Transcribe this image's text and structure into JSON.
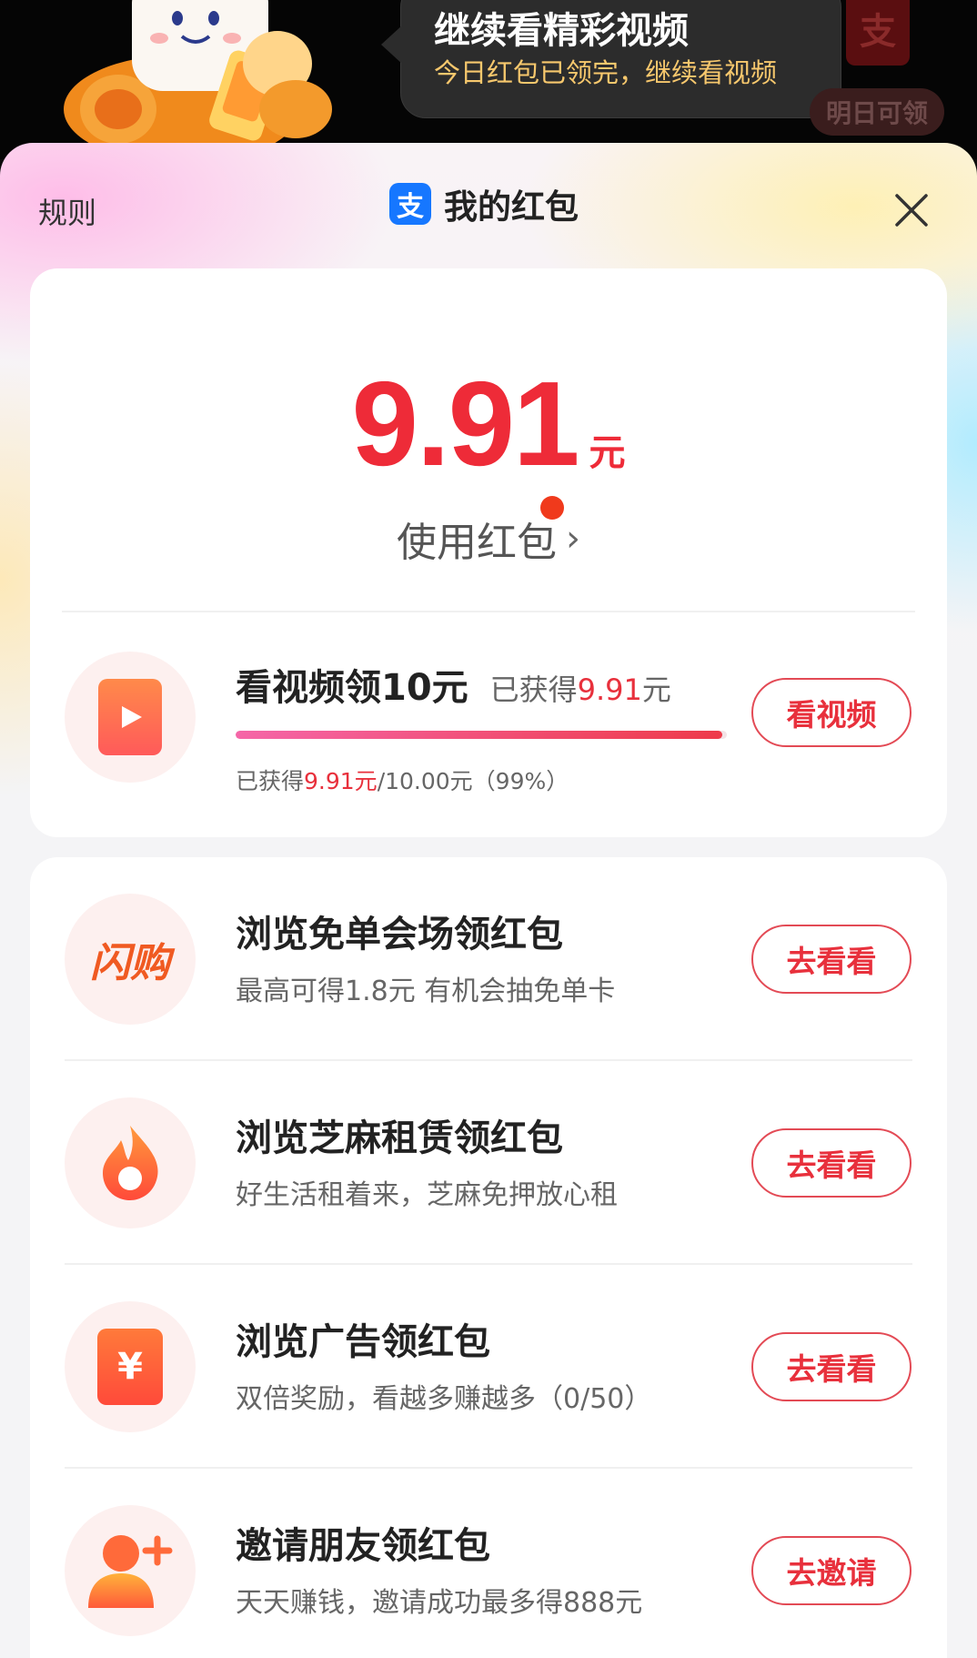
{
  "banner": {
    "tooltip_title": "继续看精彩视频",
    "tooltip_subtitle": "今日红包已领完，继续看视频",
    "envelope_glyph": "支",
    "tomorrow_label": "明日可领"
  },
  "header": {
    "rules_label": "规则",
    "logo_glyph": "支",
    "title": "我的红包"
  },
  "balance": {
    "amount": "9.91",
    "unit": "元",
    "use_label": "使用红包",
    "chevron": "›"
  },
  "video_task": {
    "icon": "play-icon",
    "title": "看视频领10元",
    "earned_prefix": "已获得",
    "earned_value": "9.91",
    "earned_unit": "元",
    "progress_prefix": "已获得",
    "progress_earned": "9.91元",
    "progress_rest": "/10.00元（99%）",
    "progress_fraction": 0.99,
    "button_label": "看视频"
  },
  "tasks": [
    {
      "icon": "flash-buy-logo-icon",
      "icon_text": "闪购",
      "title": "浏览免单会场领红包",
      "subtitle": "最高可得1.8元 有机会抽免单卡",
      "button_label": "去看看"
    },
    {
      "icon": "sesame-flame-icon",
      "title": "浏览芝麻租赁领红包",
      "subtitle": "好生活租着来，芝麻免押放心租",
      "button_label": "去看看"
    },
    {
      "icon": "yuan-envelope-icon",
      "icon_text": "¥",
      "title": "浏览广告领红包",
      "subtitle": "双倍奖励，看越多赚越多（0/50）",
      "button_label": "去看看"
    },
    {
      "icon": "add-friend-icon",
      "title": "邀请朋友领红包",
      "subtitle": "天天赚钱，邀请成功最多得888元",
      "button_label": "去邀请"
    }
  ],
  "colors": {
    "accent_red": "#e8303c",
    "alipay_blue": "#1677ff",
    "tooltip_yellow": "#f7c86d"
  }
}
